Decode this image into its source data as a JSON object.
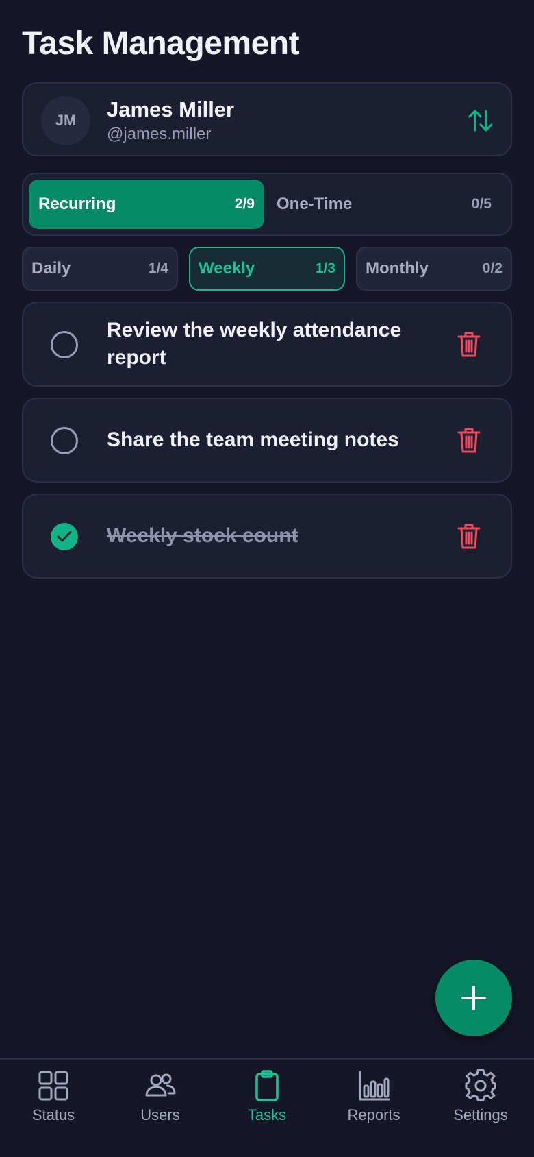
{
  "page_title": "Task Management",
  "user": {
    "initials": "JM",
    "name": "James Miller",
    "handle": "@james.miller"
  },
  "task_type_tabs": [
    {
      "label": "Recurring",
      "count": "2/9",
      "active": true
    },
    {
      "label": "One-Time",
      "count": "0/5",
      "active": false
    }
  ],
  "frequency_filters": [
    {
      "label": "Daily",
      "count": "1/4",
      "active": false
    },
    {
      "label": "Weekly",
      "count": "1/3",
      "active": true
    },
    {
      "label": "Monthly",
      "count": "0/2",
      "active": false
    }
  ],
  "tasks": [
    {
      "text": "Review the weekly attendance report",
      "completed": false
    },
    {
      "text": "Share the team meeting notes",
      "completed": false
    },
    {
      "text": "Weekly stock count",
      "completed": true
    }
  ],
  "fab_icon": "plus-icon",
  "bottom_nav": [
    {
      "label": "Status",
      "icon": "grid-icon",
      "active": false
    },
    {
      "label": "Users",
      "icon": "users-icon",
      "active": false
    },
    {
      "label": "Tasks",
      "icon": "clipboard-icon",
      "active": true
    },
    {
      "label": "Reports",
      "icon": "bar-chart-icon",
      "active": false
    },
    {
      "label": "Settings",
      "icon": "gear-icon",
      "active": false
    }
  ],
  "colors": {
    "background": "#151728",
    "card": "#1c1e31",
    "accent": "#078a66",
    "accent_text": "#1fc294",
    "danger": "#f04b5c"
  }
}
